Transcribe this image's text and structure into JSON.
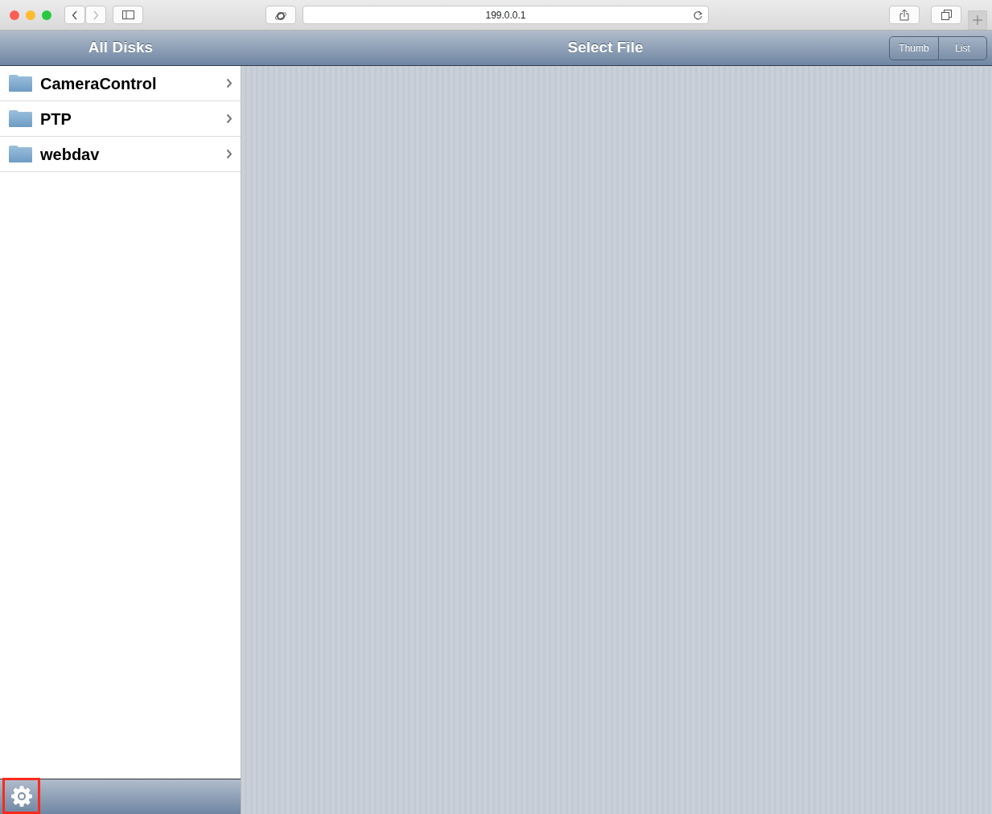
{
  "browser": {
    "address": "199.0.0.1"
  },
  "sidebar": {
    "title": "All Disks",
    "items": [
      {
        "label": "CameraControl"
      },
      {
        "label": "PTP"
      },
      {
        "label": "webdav"
      }
    ],
    "settings": {
      "highlighted": true
    }
  },
  "main": {
    "title": "Select File",
    "view_toggle": [
      {
        "label": "Thumb",
        "selected": false
      },
      {
        "label": "List",
        "selected": false
      }
    ]
  }
}
